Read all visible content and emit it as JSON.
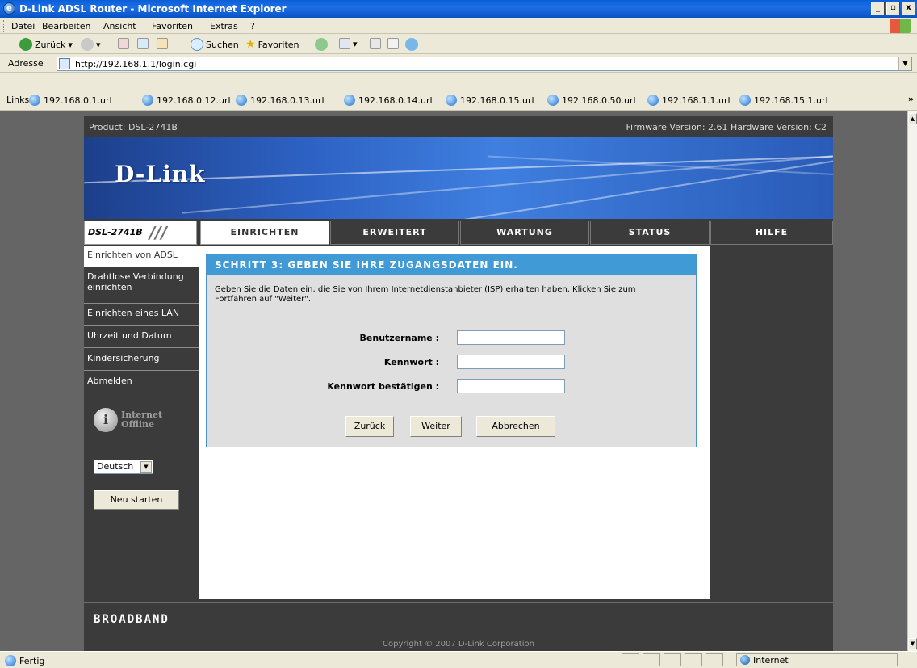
{
  "window": {
    "title": "D-Link ADSL Router - Microsoft Internet Explorer"
  },
  "menubar": {
    "items": [
      "Datei",
      "Bearbeiten",
      "Ansicht",
      "Favoriten",
      "Extras",
      "?"
    ]
  },
  "toolbar": {
    "back": "Zurück",
    "search": "Suchen",
    "favorites": "Favoriten"
  },
  "address": {
    "label": "Adresse",
    "url": "http://192.168.1.1/login.cgi"
  },
  "links": {
    "label": "Links",
    "items": [
      "192.168.0.1.url",
      "192.168.0.12.url",
      "192.168.0.13.url",
      "192.168.0.14.url",
      "192.168.0.15.url",
      "192.168.0.50.url",
      "192.168.1.1.url",
      "192.168.15.1.url"
    ]
  },
  "router": {
    "product": "Product: DSL-2741B",
    "firmware": "Firmware Version: 2.61 Hardware Version: C2",
    "logo": "D-Link",
    "model": "DSL-2741B",
    "tabs": [
      "EINRICHTEN",
      "ERWEITERT",
      "WARTUNG",
      "STATUS",
      "HILFE"
    ],
    "menu": [
      "Einrichten von ADSL",
      "Drahtlose Verbindung einrichten",
      "Einrichten eines LAN",
      "Uhrzeit und Datum",
      "Kindersicherung",
      "Abmelden"
    ],
    "status_line1": "Internet",
    "status_line2": "Offline",
    "language": "Deutsch",
    "restart": "Neu starten",
    "step_title": "SCHRITT 3: GEBEN SIE IHRE ZUGANGSDATEN EIN.",
    "description": "Geben Sie die Daten ein, die Sie von Ihrem Internetdienstanbieter (ISP) erhalten haben. Klicken Sie zum Fortfahren auf \"Weiter\".",
    "fields": {
      "username_label": "Benutzername :",
      "password_label": "Kennwort :",
      "confirm_label": "Kennwort bestätigen :"
    },
    "buttons": {
      "back": "Zurück",
      "next": "Weiter",
      "cancel": "Abbrechen"
    },
    "footer": "BROADBAND",
    "copyright": "Copyright © 2007 D-Link Corporation"
  },
  "statusbar": {
    "status": "Fertig",
    "zone": "Internet"
  }
}
